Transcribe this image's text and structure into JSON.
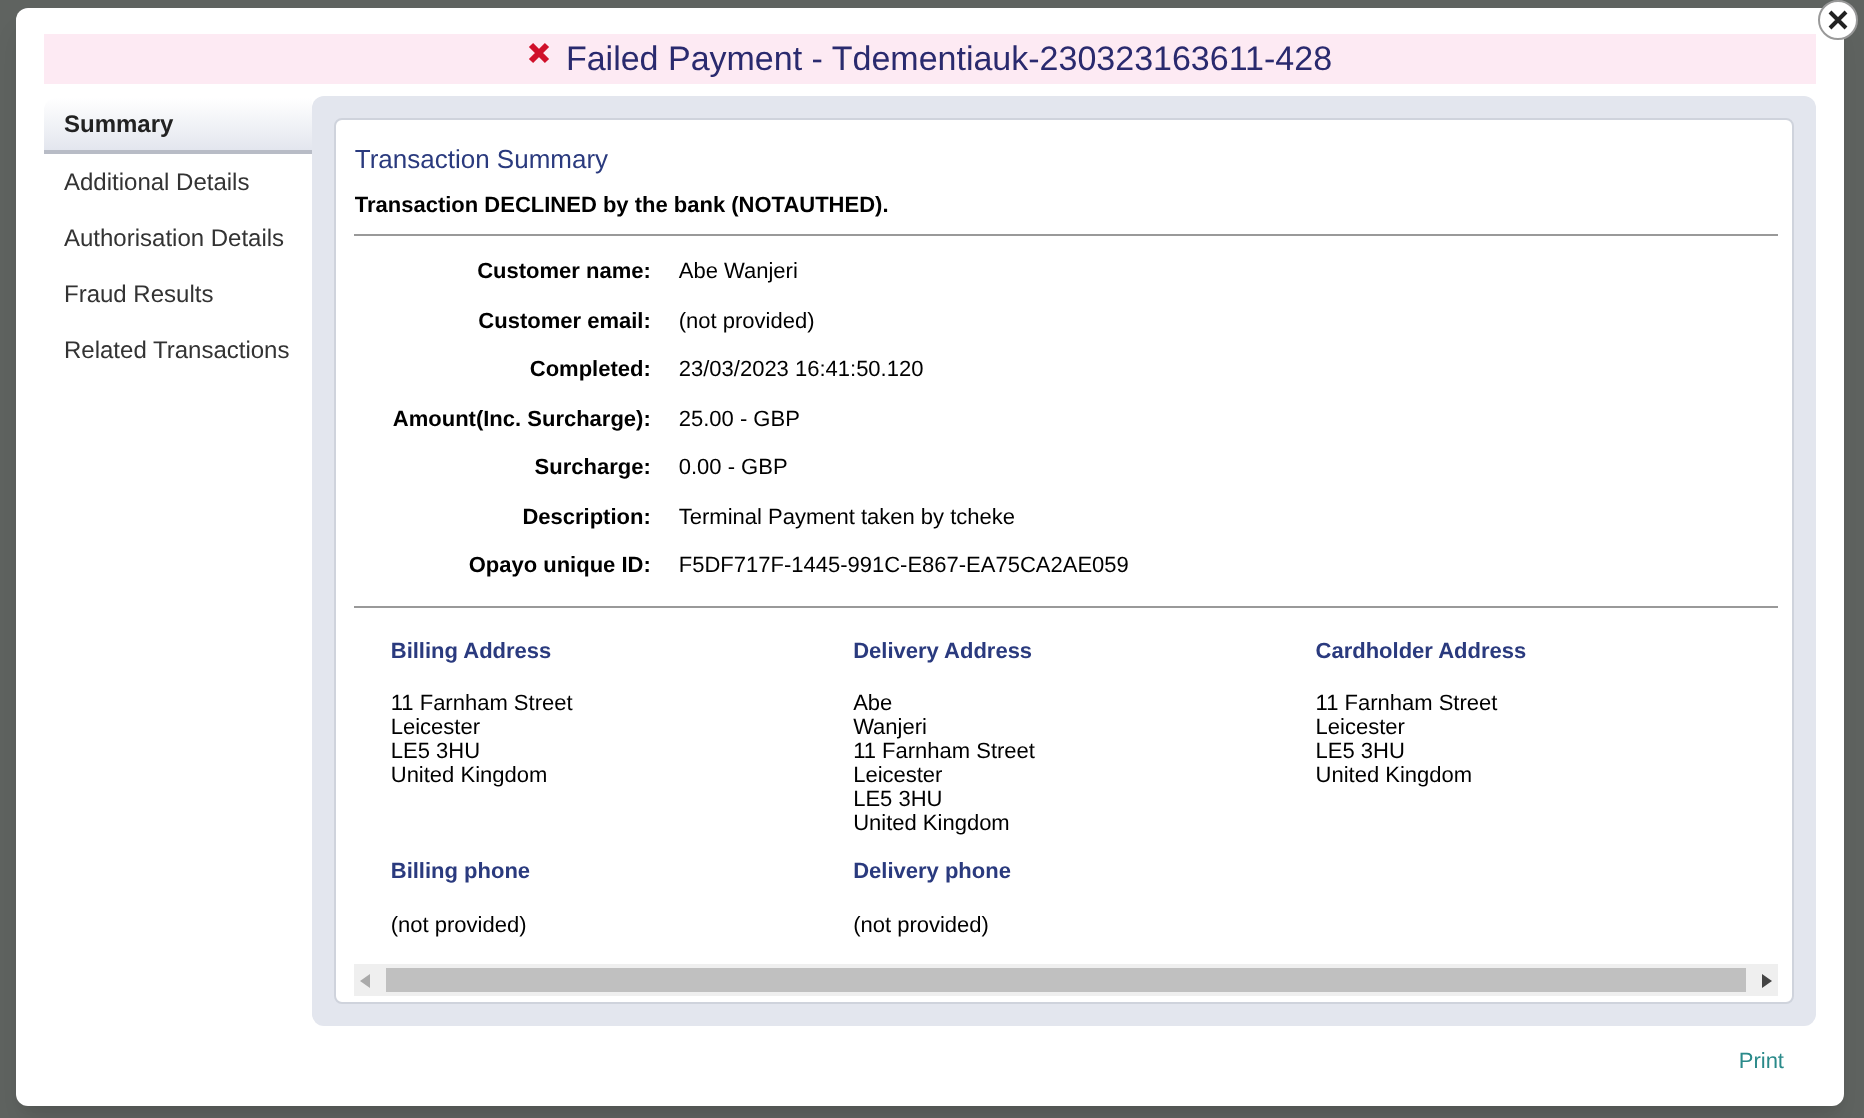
{
  "dialog": {
    "title": "Failed Payment - Tdementiauk-230323163611-428",
    "kind": "failed"
  },
  "tabs": [
    {
      "label": "Summary",
      "selected": true
    },
    {
      "label": "Additional Details",
      "selected": false
    },
    {
      "label": "Authorisation Details",
      "selected": false
    },
    {
      "label": "Fraud Results",
      "selected": false
    },
    {
      "label": "Related Transactions",
      "selected": false
    }
  ],
  "summary": {
    "heading": "Transaction Summary",
    "message": "Transaction DECLINED by the bank (NOTAUTHED).",
    "fields": [
      {
        "label": "Customer name:",
        "value": "Abe Wanjeri"
      },
      {
        "label": "Customer email:",
        "value": "(not provided)"
      },
      {
        "label": "Completed:",
        "value": "23/03/2023 16:41:50.120"
      },
      {
        "label": "Amount(Inc. Surcharge):",
        "value": "25.00 - GBP"
      },
      {
        "label": "Surcharge:",
        "value": "0.00 - GBP"
      },
      {
        "label": "Description:",
        "value": "Terminal Payment taken by tcheke"
      },
      {
        "label": "Opayo unique ID:",
        "value": "F5DF717F-1445-991C-E867-EA75CA2AE059"
      }
    ],
    "addresses": [
      {
        "heading": "Billing Address",
        "lines": [
          "11 Farnham Street",
          "Leicester",
          "LE5 3HU",
          "United Kingdom"
        ]
      },
      {
        "heading": "Delivery Address",
        "lines": [
          "Abe",
          "Wanjeri",
          "11 Farnham Street",
          "Leicester",
          "LE5 3HU",
          "United Kingdom"
        ]
      },
      {
        "heading": "Cardholder Address",
        "lines": [
          "11 Farnham Street",
          "Leicester",
          "LE5 3HU",
          "United Kingdom"
        ]
      }
    ],
    "phones": [
      {
        "heading": "Billing phone",
        "value": "(not provided)"
      },
      {
        "heading": "Delivery phone",
        "value": "(not provided)"
      }
    ]
  },
  "print": "Print"
}
